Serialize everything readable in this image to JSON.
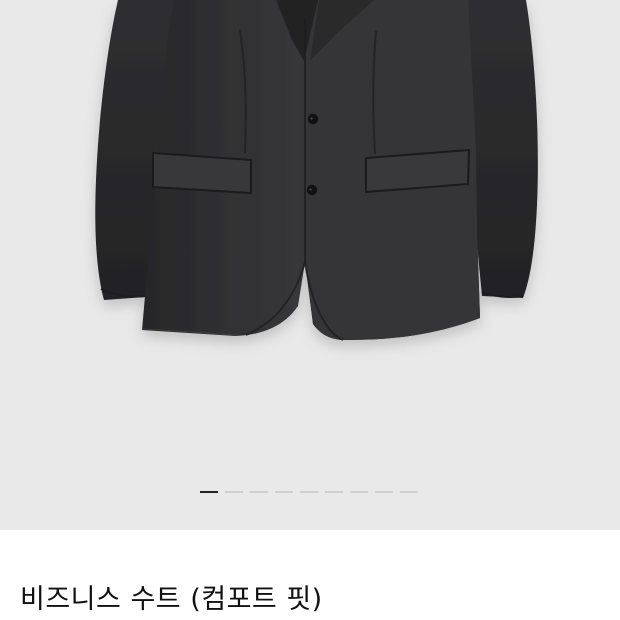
{
  "product": {
    "title": "비즈니스 수트 (컴포트 핏)",
    "image_icon": "suit-jacket-photo"
  },
  "gallery": {
    "page_count": 9,
    "active_page": 1
  },
  "colors": {
    "gallery_background": "#e9e9e9",
    "pager_inactive": "#cfcfcf",
    "pager_active": "#222222",
    "jacket": "#2e2e30"
  }
}
